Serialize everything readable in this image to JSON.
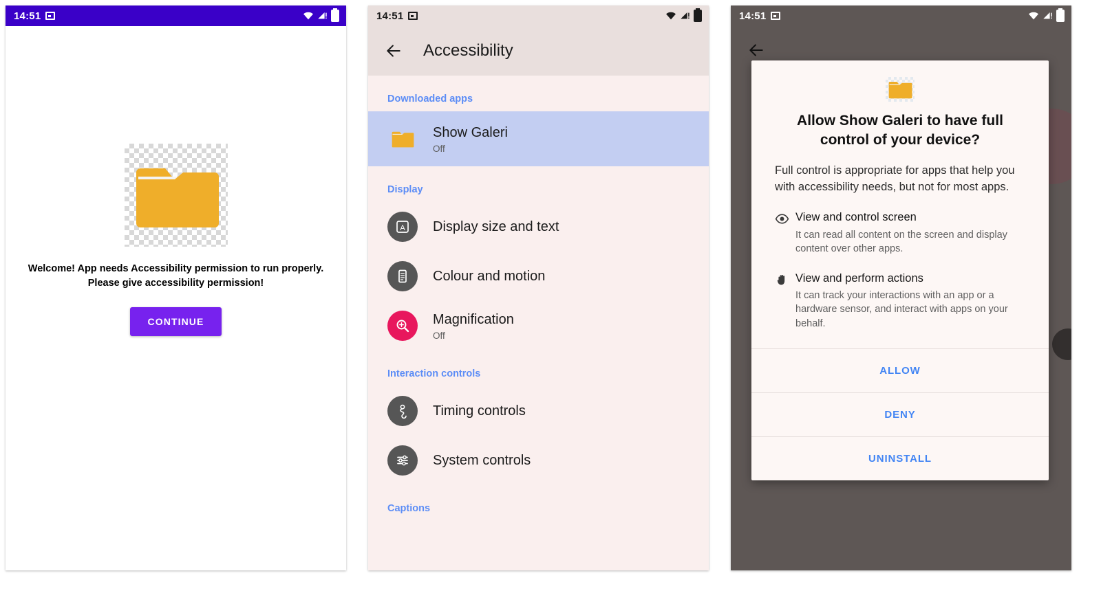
{
  "status_bar": {
    "time": "14:51",
    "icons": [
      "cast-icon",
      "wifi-icon",
      "signal-icon",
      "battery-icon"
    ]
  },
  "colors": {
    "panel1_statusbar": "#3A00C8",
    "continue_button": "#7722EE",
    "section_heading": "#5C8DF6",
    "selected_row": "#C3CEF2",
    "magnification_icon": "#E8175D",
    "dialog_action": "#4285F4",
    "scrim": "#5E5755"
  },
  "panel1": {
    "app_icon": "folder-icon",
    "message": "Welcome! App needs Accessibility permission to run properly. Please give accessibility permission!",
    "continue_label": "CONTINUE"
  },
  "panel2": {
    "back_icon": "back-arrow-icon",
    "title": "Accessibility",
    "sections": [
      {
        "heading": "Downloaded apps",
        "items": [
          {
            "icon": "folder-icon",
            "title": "Show Galeri",
            "subtitle": "Off",
            "selected": true
          }
        ]
      },
      {
        "heading": "Display",
        "items": [
          {
            "icon": "display-size-icon",
            "title": "Display size and text",
            "subtitle": "",
            "selected": false
          },
          {
            "icon": "colour-motion-icon",
            "title": "Colour and motion",
            "subtitle": "",
            "selected": false
          },
          {
            "icon": "magnification-icon",
            "title": "Magnification",
            "subtitle": "Off",
            "selected": false
          }
        ]
      },
      {
        "heading": "Interaction controls",
        "items": [
          {
            "icon": "timing-controls-icon",
            "title": "Timing controls",
            "subtitle": "",
            "selected": false
          },
          {
            "icon": "system-controls-icon",
            "title": "System controls",
            "subtitle": "",
            "selected": false
          }
        ]
      },
      {
        "heading": "Captions",
        "items": []
      }
    ]
  },
  "panel3": {
    "back_icon": "back-arrow-icon",
    "dialog": {
      "app_icon": "folder-icon",
      "title": "Allow Show Galeri to have full control of your device?",
      "description": "Full control is appropriate for apps that help you with accessibility needs, but not for most apps.",
      "capabilities": [
        {
          "icon": "eye-icon",
          "title": "View and control screen",
          "detail": "It can read all content on the screen and display content over other apps."
        },
        {
          "icon": "hand-icon",
          "title": "View and perform actions",
          "detail": "It can track your interactions with an app or a hardware sensor, and interact with apps on your behalf."
        }
      ],
      "actions": [
        {
          "label": "ALLOW"
        },
        {
          "label": "DENY"
        },
        {
          "label": "UNINSTALL"
        }
      ]
    }
  }
}
